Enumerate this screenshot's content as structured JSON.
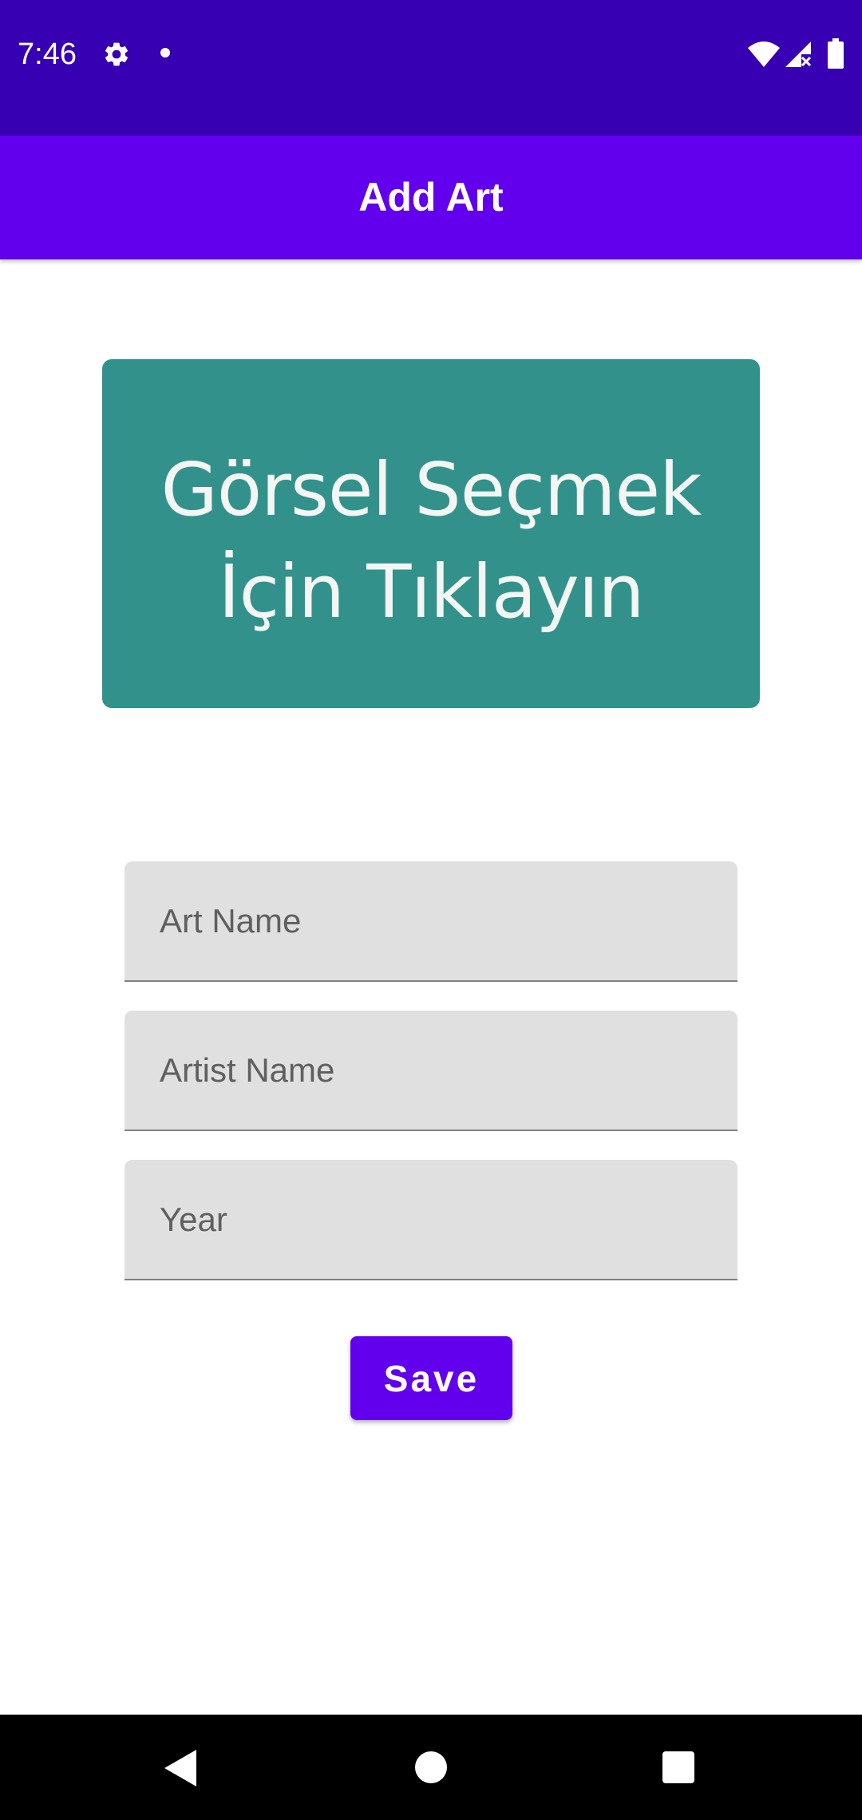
{
  "status_bar": {
    "time": "7:46",
    "icons": [
      "gear-icon",
      "dot-icon",
      "wifi-icon",
      "signal-icon",
      "battery-icon"
    ]
  },
  "app_bar": {
    "title": "Add Art"
  },
  "image_picker": {
    "line1": "Görsel Seçmek",
    "line2": "İçin Tıklayın"
  },
  "form": {
    "art_name": {
      "value": "",
      "placeholder": "Art Name"
    },
    "artist_name": {
      "value": "",
      "placeholder": "Artist Name"
    },
    "year": {
      "value": "",
      "placeholder": "Year"
    },
    "save_label": "Save"
  },
  "nav_bar": {
    "icons": [
      "back-icon",
      "home-icon",
      "recents-icon"
    ]
  },
  "colors": {
    "status_bar": "#3700B3",
    "primary": "#6200EE",
    "picker_background": "#32928B",
    "field_background": "#E0E0E0",
    "nav_bar": "#000000"
  }
}
